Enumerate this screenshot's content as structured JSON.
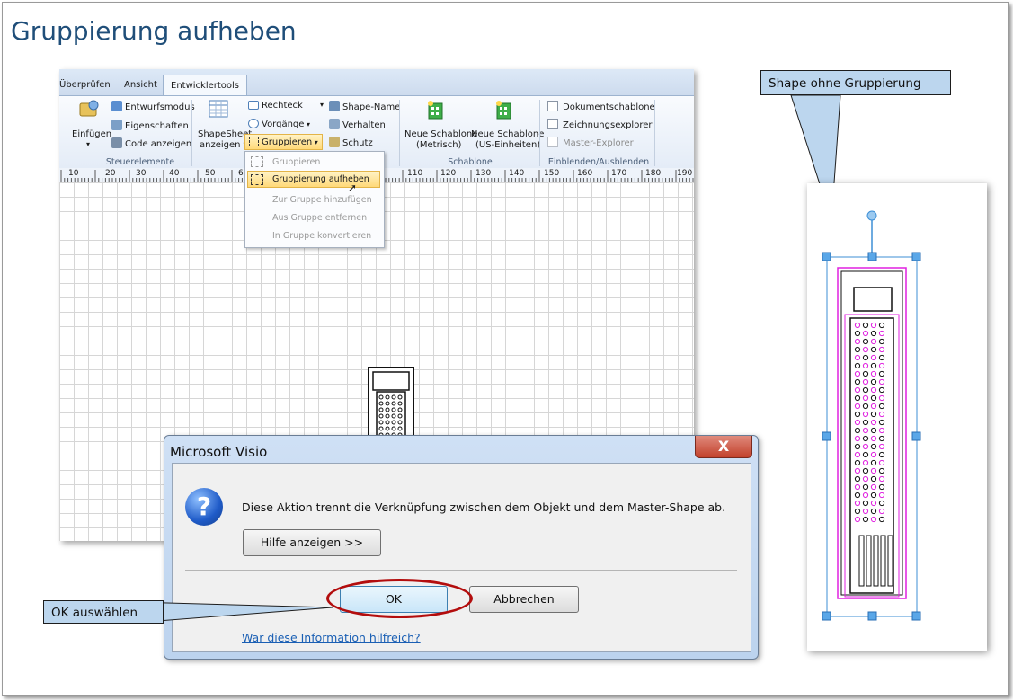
{
  "page_title": "Gruppierung aufheben",
  "ribbon": {
    "tabs": [
      "Überprüfen",
      "Ansicht",
      "Entwicklertools"
    ],
    "active_tab": "Entwicklertools",
    "controls": {
      "einfuegen": "Einfügen",
      "entwurfsmodus": "Entwurfsmodus",
      "eigenschaften": "Eigenschaften",
      "code_anzeigen": "Code anzeigen",
      "shapesheet_line1": "ShapeSheet",
      "shapesheet_line2": "anzeigen ▾",
      "rechteck": "Rechteck",
      "vorgaenge": "Vorgänge",
      "gruppieren": "Gruppieren",
      "shape_name": "Shape-Name",
      "verhalten": "Verhalten",
      "schutz": "Schutz",
      "neue_schablone_metrisch_line1": "Neue Schablone",
      "neue_schablone_metrisch_line2": "(Metrisch)",
      "neue_schablone_us_line1": "Neue Schablone",
      "neue_schablone_us_line2": "(US-Einheiten)",
      "dokumentschablone": "Dokumentschablone",
      "zeichnungsexplorer": "Zeichnungsexplorer",
      "master_explorer": "Master-Explorer"
    },
    "groups": {
      "steuerelemente": "Steuerelemente",
      "schablone": "Schablone",
      "einblenden": "Einblenden/Ausblenden"
    }
  },
  "ruler_ticks": [
    "10",
    "20",
    "30",
    "40",
    "50",
    "60",
    "110",
    "120",
    "130",
    "140",
    "150",
    "160",
    "170",
    "180",
    "190"
  ],
  "group_menu": {
    "items": [
      {
        "label": "Gruppieren",
        "enabled": false
      },
      {
        "label": "Gruppierung aufheben",
        "enabled": true
      },
      {
        "label": "Zur Gruppe hinzufügen",
        "enabled": false
      },
      {
        "label": "Aus Gruppe entfernen",
        "enabled": false
      },
      {
        "label": "In Gruppe konvertieren",
        "enabled": false
      }
    ]
  },
  "dialog": {
    "title": "Microsoft Visio",
    "close_symbol": "X",
    "message": "Diese Aktion trennt die Verknüpfung zwischen dem Objekt und dem Master-Shape ab.",
    "help_button": "Hilfe anzeigen >>",
    "ok_button": "OK",
    "cancel_button": "Abbrechen",
    "feedback_link": "War diese Information hilfreich?"
  },
  "callouts": {
    "shape": "Shape ohne Gruppierung",
    "ok": "OK auswählen"
  },
  "colors": {
    "title": "#1f4e79",
    "callout_fill": "#bcd6ee",
    "highlight_oval": "#b30d0d",
    "selection_handles": "#3d8fd6",
    "shape_outline": "#e020e0"
  }
}
